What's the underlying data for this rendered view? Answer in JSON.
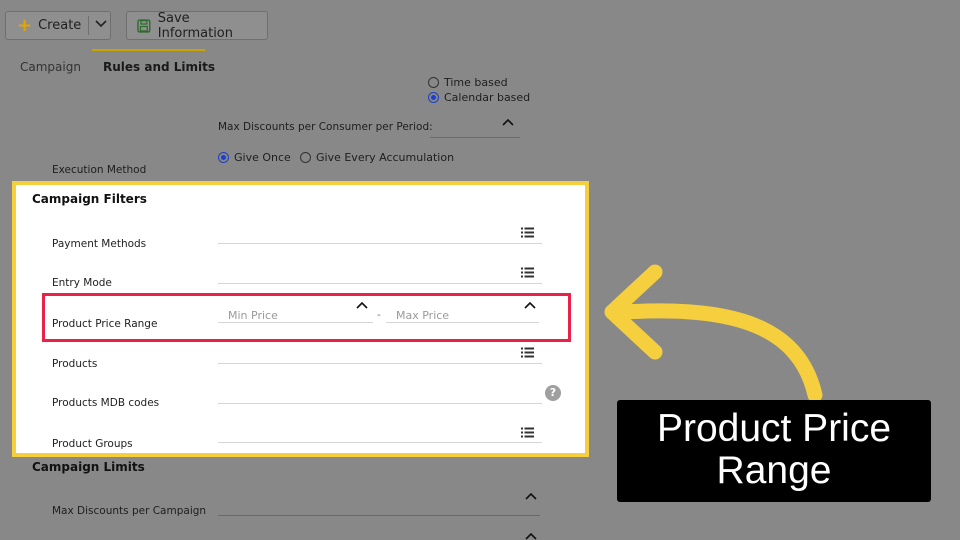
{
  "toolbar": {
    "create_label": "Create",
    "save_label": "Save Information"
  },
  "tabs": [
    {
      "label": "Campaign",
      "active": false
    },
    {
      "label": "Rules and Limits",
      "active": true
    }
  ],
  "period_type": {
    "options": [
      {
        "label": "Time based",
        "selected": false
      },
      {
        "label": "Calendar based",
        "selected": true
      }
    ]
  },
  "max_discounts_per_consumer_label": "Max Discounts per Consumer per Period:",
  "execution_method": {
    "label": "Execution Method",
    "options": [
      {
        "label": "Give Once",
        "selected": true
      },
      {
        "label": "Give Every Accumulation",
        "selected": false
      }
    ]
  },
  "campaign_filters": {
    "title": "Campaign Filters",
    "payment_methods_label": "Payment Methods",
    "entry_mode_label": "Entry Mode",
    "product_price_range": {
      "label": "Product Price Range",
      "min_placeholder": "Min Price",
      "separator": "-",
      "max_placeholder": "Max Price"
    },
    "products_label": "Products",
    "products_mdb_label": "Products MDB codes",
    "product_groups_label": "Product Groups",
    "help_glyph": "?"
  },
  "campaign_limits": {
    "title": "Campaign Limits",
    "max_discounts_per_campaign_label": "Max Discounts per Campaign"
  },
  "callout": {
    "line1": "Product Price",
    "line2": "Range"
  },
  "colors": {
    "overlay": "#888888",
    "highlight_border": "#f6cf3e",
    "focus_box": "#ea2249",
    "arrow": "#f6cf3e",
    "radio_selected": "#1a3fd0",
    "callout_bg": "#000000"
  },
  "icons": {
    "create": "plus-icon",
    "dropdown": "chevron-down-icon",
    "save": "save-disk-icon",
    "list": "list-icon",
    "stepper": "caret-up-icon",
    "help": "help-icon"
  }
}
